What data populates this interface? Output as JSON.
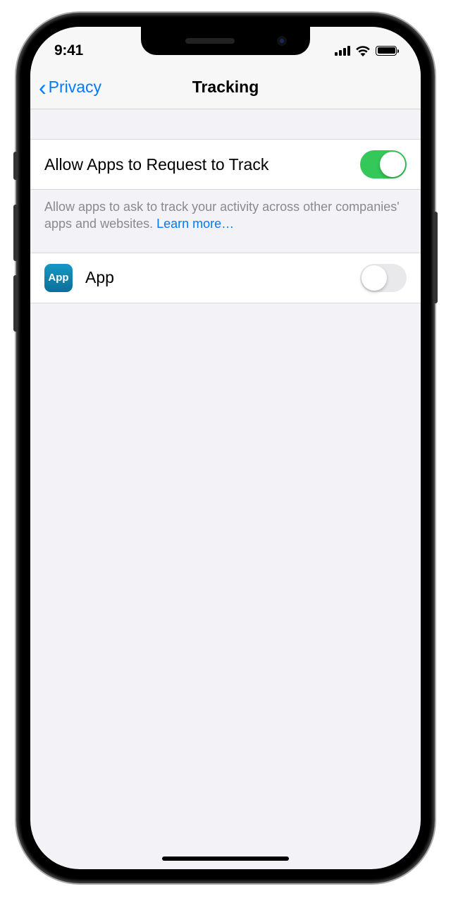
{
  "status": {
    "time": "9:41"
  },
  "nav": {
    "back_label": "Privacy",
    "title": "Tracking"
  },
  "settings": {
    "allow_request": {
      "label": "Allow Apps to Request to Track",
      "on": true
    },
    "footer_text": "Allow apps to ask to track your activity across other companies' apps and websites. ",
    "learn_more": "Learn more…"
  },
  "apps": [
    {
      "icon_text": "App",
      "name": "App",
      "on": false
    }
  ]
}
